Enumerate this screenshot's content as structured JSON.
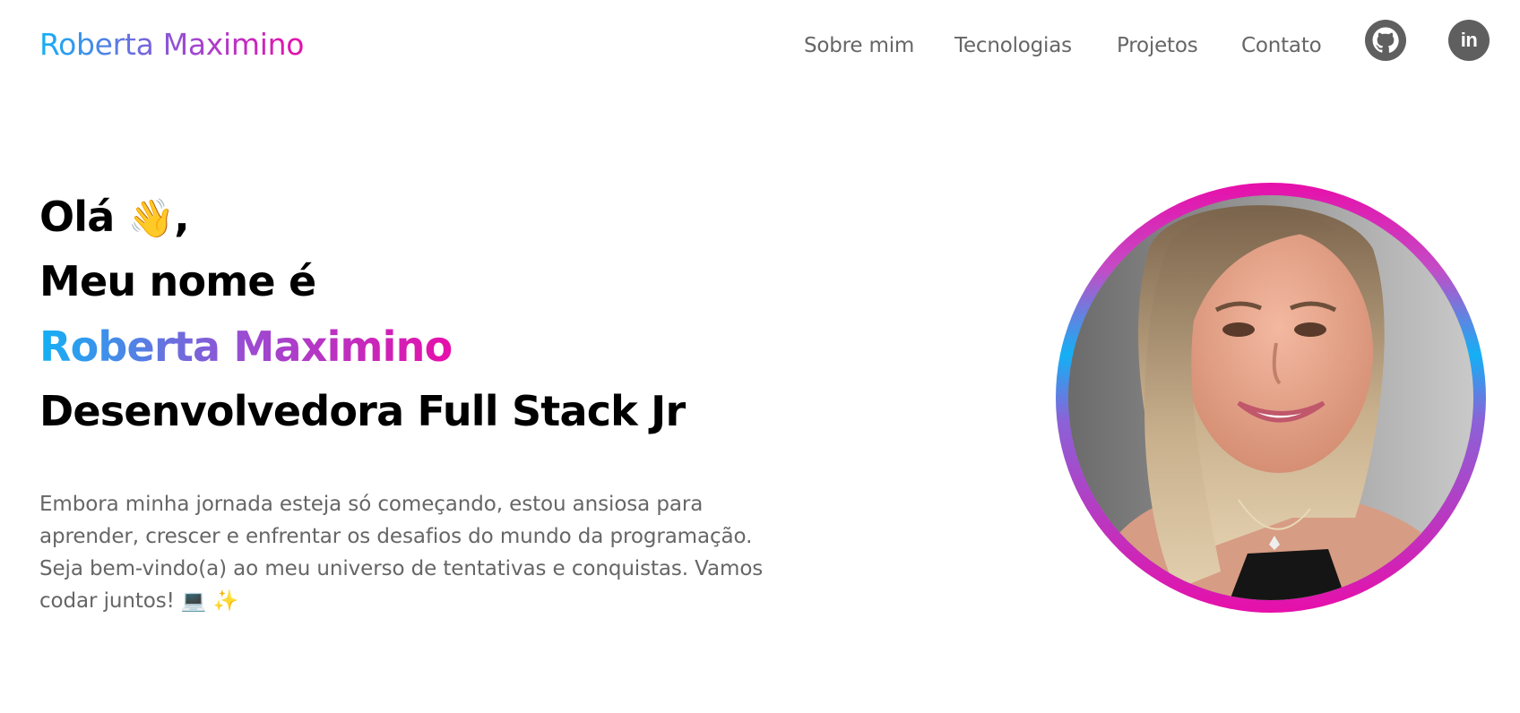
{
  "header": {
    "brand": "Roberta Maximino",
    "nav": [
      {
        "label": "Sobre mim"
      },
      {
        "label": "Tecnologias"
      },
      {
        "label": "Projetos"
      },
      {
        "label": "Contato"
      }
    ],
    "social": [
      {
        "icon": "github-icon"
      },
      {
        "icon": "linkedin-icon",
        "glyph": "in"
      }
    ]
  },
  "hero": {
    "greeting": "Olá",
    "greeting_emoji": "👋",
    "greeting_suffix": ",",
    "line2": "Meu nome é",
    "name": "Roberta Maximino",
    "role": "Desenvolvedora Full Stack Jr",
    "intro": "Embora minha jornada esteja só começando, estou ansiosa para aprender, crescer e enfrentar os desafios do mundo da programação. Seja bem-vindo(a) ao meu universo de tentativas e conquistas. Vamos codar juntos! 💻 ✨"
  },
  "colors": {
    "gradient_start": "#13b0f5",
    "gradient_mid": "#9b4bd2",
    "gradient_end": "#e70faa",
    "nav_text": "#666666",
    "icon_fill": "#5f5f5f"
  }
}
